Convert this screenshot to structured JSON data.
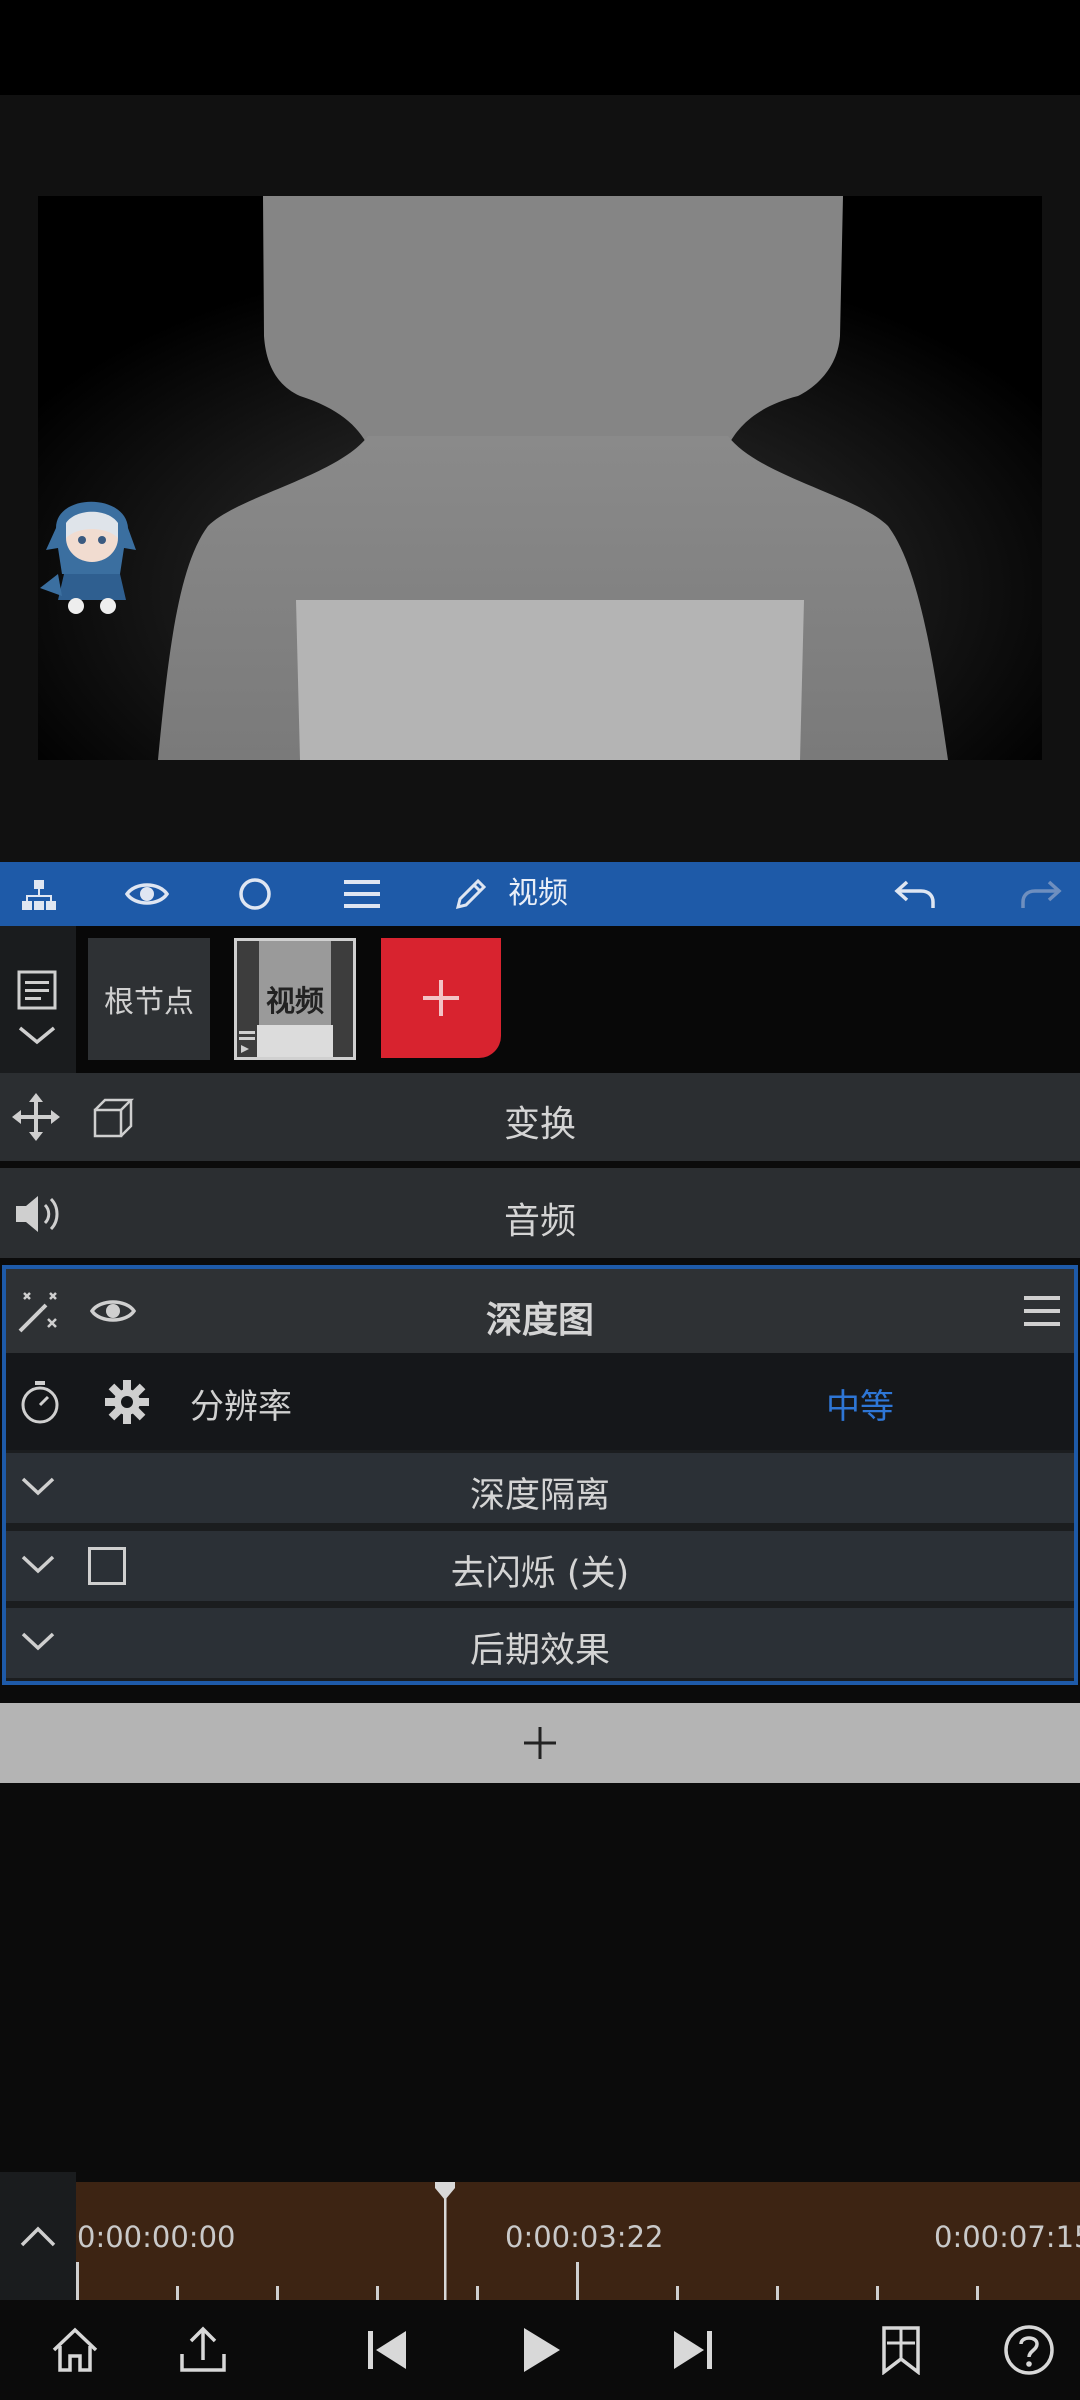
{
  "toolbar": {
    "layer_label": "视频"
  },
  "layers": {
    "root_label": "根节点",
    "video_label": "视频"
  },
  "panels": {
    "transform": "变换",
    "audio": "音频"
  },
  "effect": {
    "title": "深度图",
    "param_label": "分辨率",
    "param_value": "中等",
    "sections": [
      "深度隔离",
      "去闪烁 (关)",
      "后期效果"
    ]
  },
  "timeline": {
    "timecodes": [
      "0:00:00:00",
      "0:00:03:22",
      "0:00:07:15"
    ]
  },
  "colors": {
    "accent": "#1e5aa8",
    "add_layer": "#d8232f",
    "param_value": "#2e76d6",
    "timeline_bg": "#3d2413"
  },
  "icons": {
    "toolbar": [
      "layer-tree-icon",
      "eye-icon",
      "circle-icon",
      "menu-icon",
      "pencil-icon",
      "undo-icon",
      "redo-icon"
    ],
    "bottom": [
      "home-icon",
      "share-icon",
      "skip-back-icon",
      "play-icon",
      "skip-forward-icon",
      "bookmark-icon",
      "help-icon"
    ]
  }
}
